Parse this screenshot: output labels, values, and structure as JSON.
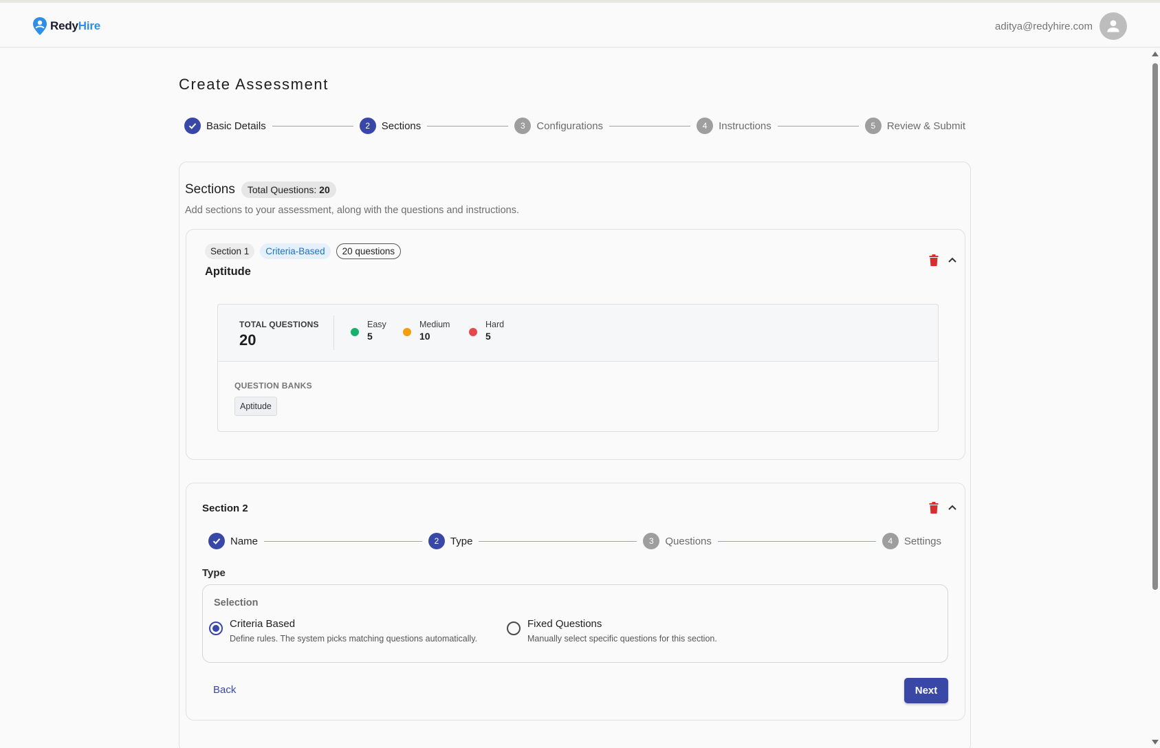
{
  "header": {
    "brand_part1": "Redy",
    "brand_part2": "Hire",
    "user_email": "aditya@redyhire.com",
    "brand_color": "#2f8fe6"
  },
  "page": {
    "title": "Create Assessment"
  },
  "stepper": [
    {
      "num": "1",
      "label": "Basic Details",
      "state": "done"
    },
    {
      "num": "2",
      "label": "Sections",
      "state": "active"
    },
    {
      "num": "3",
      "label": "Configurations",
      "state": "pending"
    },
    {
      "num": "4",
      "label": "Instructions",
      "state": "pending"
    },
    {
      "num": "5",
      "label": "Review & Submit",
      "state": "pending"
    }
  ],
  "sections_card": {
    "heading": "Sections",
    "total_label": "Total Questions: ",
    "total_value": "20",
    "subtitle": "Add sections to your assessment, along with the questions and instructions."
  },
  "section1": {
    "tag": "Section 1",
    "type_chip": "Criteria-Based",
    "count_chip": "20 questions",
    "name": "Aptitude",
    "stats": {
      "total_label": "TOTAL QUESTIONS",
      "total_value": "20",
      "easy_label": "Easy",
      "easy_value": "5",
      "medium_label": "Medium",
      "medium_value": "10",
      "hard_label": "Hard",
      "hard_value": "5"
    },
    "banks_label": "QUESTION BANKS",
    "banks": [
      "Aptitude"
    ]
  },
  "section2": {
    "title": "Section 2",
    "stepper": [
      {
        "num": "1",
        "label": "Name",
        "state": "done"
      },
      {
        "num": "2",
        "label": "Type",
        "state": "active"
      },
      {
        "num": "3",
        "label": "Questions",
        "state": "pending"
      },
      {
        "num": "4",
        "label": "Settings",
        "state": "pending"
      }
    ],
    "type_label": "Type",
    "selection_label": "Selection",
    "option1_title": "Criteria Based",
    "option1_desc": "Define rules. The system picks matching questions automatically.",
    "option2_title": "Fixed Questions",
    "option2_desc": "Manually select specific questions for this section.",
    "back_label": "Back",
    "next_label": "Next"
  },
  "colors": {
    "primary": "#3947a6",
    "easy": "#17b26a",
    "medium": "#f59e0b",
    "hard": "#e5484d",
    "danger": "#d32f2f"
  }
}
